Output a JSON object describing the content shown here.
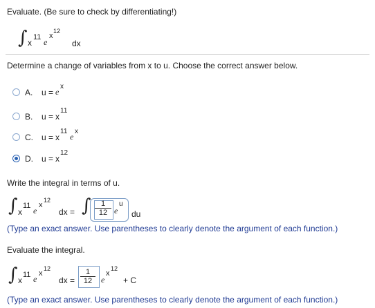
{
  "problem": {
    "instruction": "Evaluate. (Be sure to check by differentiating!)",
    "integral": {
      "symbol": "∫",
      "x": "x",
      "x_exp": "11",
      "e": "e",
      "e_exp_base": "x",
      "e_exp_power": "12",
      "dx": "dx"
    }
  },
  "part1": {
    "prompt": "Determine a change of variables from x to u. Choose the correct answer below.",
    "options": [
      {
        "letter": "A.",
        "lhs": "u =",
        "rhs": "e",
        "sup": "x",
        "selected": false
      },
      {
        "letter": "B.",
        "lhs": "u =",
        "rhs": "x",
        "sup": "11",
        "selected": false
      },
      {
        "letter": "C.",
        "lhs": "u =",
        "rhs": "x",
        "sup": "11",
        "extra": "e",
        "extra_sup": "x",
        "selected": false
      },
      {
        "letter": "D.",
        "lhs": "u =",
        "rhs": "x",
        "sup": "12",
        "selected": true
      }
    ]
  },
  "part2": {
    "prompt": "Write the integral in terms of u.",
    "lhs": {
      "symbol": "∫",
      "x": "x",
      "x_exp": "11",
      "e": "e",
      "e_exp_base": "x",
      "e_exp_power": "12",
      "dx": "dx ="
    },
    "rhs": {
      "symbol": "∫",
      "frac_num": "1",
      "frac_den": "12",
      "e": "e",
      "e_exp": "u",
      "du": "du"
    },
    "note": "(Type an exact answer. Use parentheses to clearly denote the argument of each function.)"
  },
  "part3": {
    "prompt": "Evaluate the integral.",
    "lhs": {
      "symbol": "∫",
      "x": "x",
      "x_exp": "11",
      "e": "e",
      "e_exp_base": "x",
      "e_exp_power": "12",
      "dx": "dx ="
    },
    "answer": {
      "frac_num": "1",
      "frac_den": "12",
      "e": "e",
      "e_exp_base": "x",
      "e_exp_power": "12",
      "c": "+ C"
    },
    "note": "(Type an exact answer. Use parentheses to clearly denote the argument of each function.)"
  },
  "colors": {
    "divider": "#c8c8c8",
    "note_text": "#1f3a93",
    "radio_selected": "#2a62b3",
    "box_border": "#7a9cc6"
  }
}
